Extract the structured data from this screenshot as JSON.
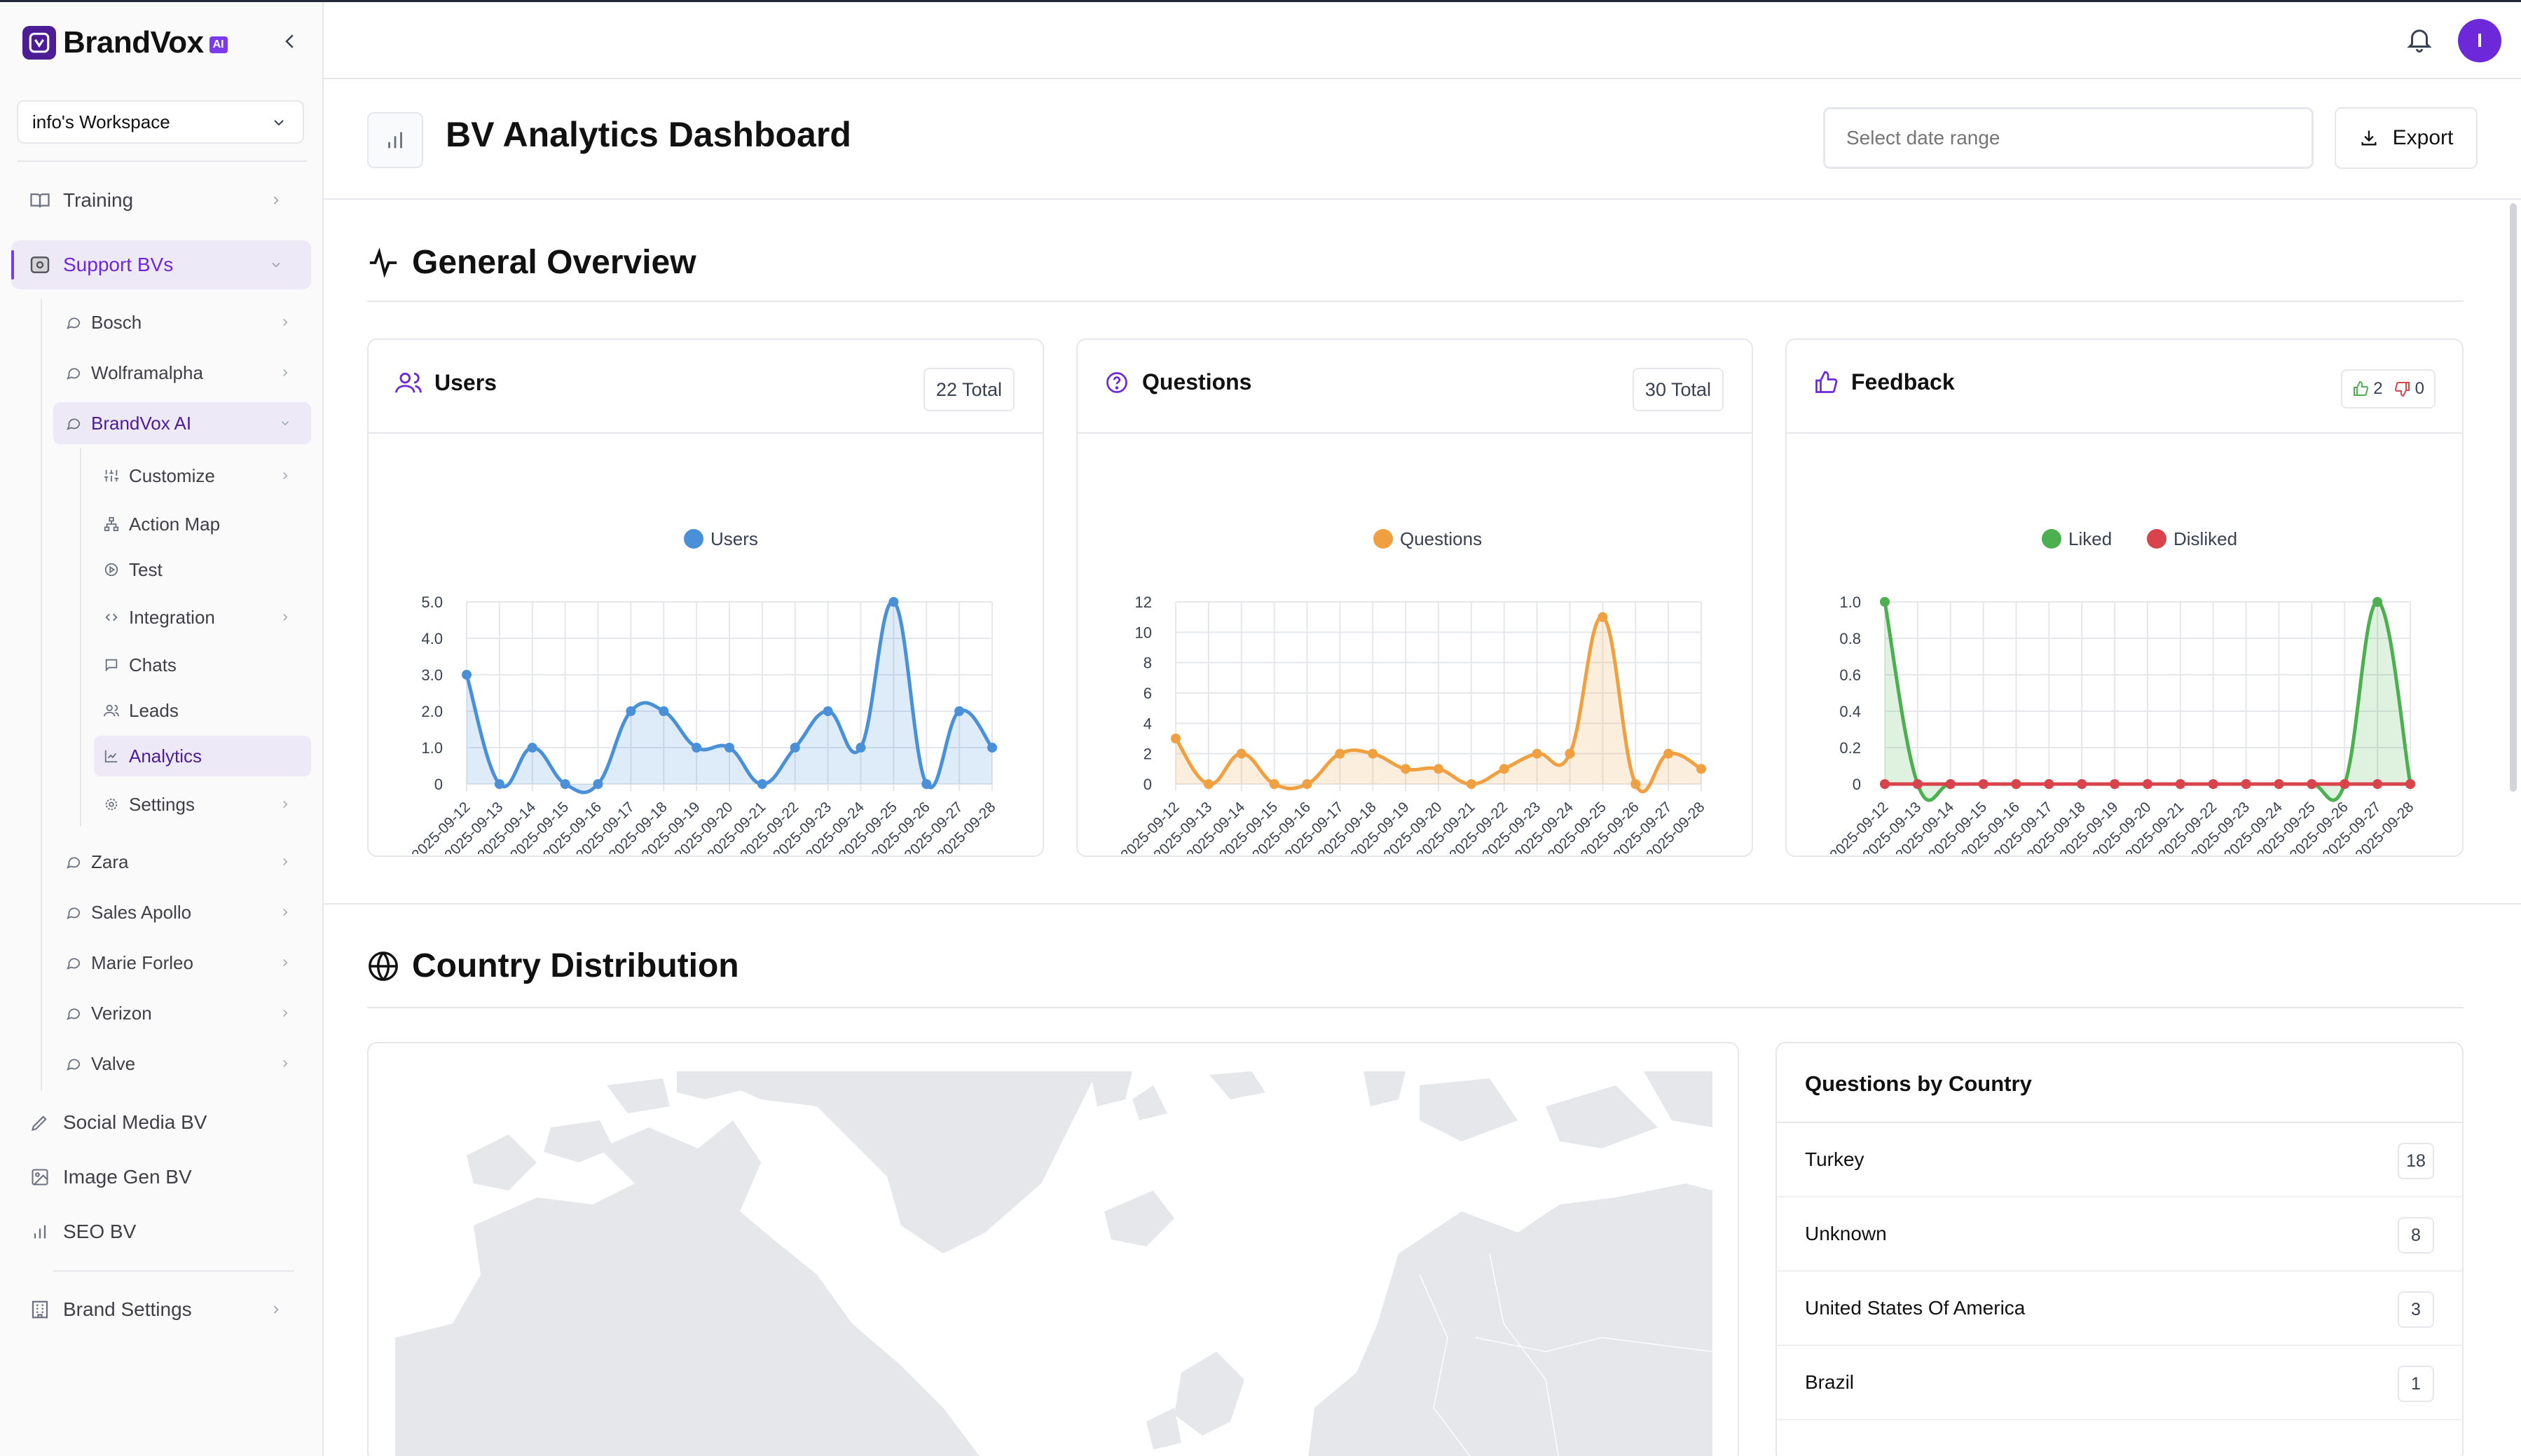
{
  "brand": {
    "name": "BrandVox",
    "badge": "AI"
  },
  "workspace": {
    "label": "info's Workspace"
  },
  "nav": {
    "training": "Training",
    "support_bvs": "Support BVs",
    "bots": {
      "bosch": "Bosch",
      "wolframalpha": "Wolframalpha",
      "brandvox_ai": "BrandVox AI",
      "zara": "Zara",
      "sales_apollo": "Sales Apollo",
      "marie_forleo": "Marie Forleo",
      "verizon": "Verizon",
      "valve": "Valve"
    },
    "bot_sub": {
      "customize": "Customize",
      "action_map": "Action Map",
      "test": "Test",
      "integration": "Integration",
      "chats": "Chats",
      "leads": "Leads",
      "analytics": "Analytics",
      "settings": "Settings"
    },
    "social_media": "Social Media BV",
    "image_gen": "Image Gen BV",
    "seo": "SEO BV",
    "brand_settings": "Brand Settings"
  },
  "user": {
    "initial": "I"
  },
  "page": {
    "title": "BV Analytics Dashboard",
    "date_placeholder": "Select date range",
    "export_label": "Export"
  },
  "sections": {
    "overview": "General Overview",
    "country": "Country Distribution"
  },
  "cards": {
    "users": {
      "title": "Users",
      "total": "22 Total"
    },
    "questions": {
      "title": "Questions",
      "total": "30 Total"
    },
    "feedback": {
      "title": "Feedback",
      "liked": "2",
      "disliked": "0"
    }
  },
  "colors": {
    "accent": "#6d28d9",
    "users": "#4a90d9",
    "questions": "#f0a040",
    "liked": "#4caf50",
    "disliked": "#d9434b"
  },
  "chart_data": [
    {
      "type": "line",
      "x": [
        "2025-09-12",
        "2025-09-13",
        "2025-09-14",
        "2025-09-15",
        "2025-09-16",
        "2025-09-17",
        "2025-09-18",
        "2025-09-19",
        "2025-09-20",
        "2025-09-21",
        "2025-09-22",
        "2025-09-23",
        "2025-09-24",
        "2025-09-25",
        "2025-09-26",
        "2025-09-27",
        "2025-09-28"
      ],
      "series": [
        {
          "name": "Users",
          "values": [
            3,
            0,
            1,
            0,
            0,
            2,
            2,
            1,
            1,
            0,
            1,
            2,
            1,
            5,
            0,
            2,
            1
          ]
        }
      ],
      "ylim": [
        0,
        5
      ],
      "yticks": [
        "0",
        "1.0",
        "2.0",
        "3.0",
        "4.0",
        "5.0"
      ],
      "legend": "top",
      "grid": true
    },
    {
      "type": "line",
      "x": [
        "2025-09-12",
        "2025-09-13",
        "2025-09-14",
        "2025-09-15",
        "2025-09-16",
        "2025-09-17",
        "2025-09-18",
        "2025-09-19",
        "2025-09-20",
        "2025-09-21",
        "2025-09-22",
        "2025-09-23",
        "2025-09-24",
        "2025-09-25",
        "2025-09-26",
        "2025-09-27",
        "2025-09-28"
      ],
      "series": [
        {
          "name": "Questions",
          "values": [
            3,
            0,
            2,
            0,
            0,
            2,
            2,
            1,
            1,
            0,
            1,
            2,
            2,
            11,
            0,
            2,
            1
          ]
        }
      ],
      "ylim": [
        0,
        12
      ],
      "yticks": [
        "0",
        "2",
        "4",
        "6",
        "8",
        "10",
        "12"
      ],
      "legend": "top",
      "grid": true
    },
    {
      "type": "line",
      "x": [
        "2025-09-12",
        "2025-09-13",
        "2025-09-14",
        "2025-09-15",
        "2025-09-16",
        "2025-09-17",
        "2025-09-18",
        "2025-09-19",
        "2025-09-20",
        "2025-09-21",
        "2025-09-22",
        "2025-09-23",
        "2025-09-24",
        "2025-09-25",
        "2025-09-26",
        "2025-09-27",
        "2025-09-28"
      ],
      "series": [
        {
          "name": "Liked",
          "values": [
            1,
            0,
            0,
            0,
            0,
            0,
            0,
            0,
            0,
            0,
            0,
            0,
            0,
            0,
            0,
            1,
            0
          ]
        },
        {
          "name": "Disliked",
          "values": [
            0,
            0,
            0,
            0,
            0,
            0,
            0,
            0,
            0,
            0,
            0,
            0,
            0,
            0,
            0,
            0,
            0
          ]
        }
      ],
      "ylim": [
        0,
        1
      ],
      "yticks": [
        "0",
        "0.2",
        "0.4",
        "0.6",
        "0.8",
        "1.0"
      ],
      "legend": "top",
      "grid": true
    }
  ],
  "questions_by_country": {
    "title": "Questions by Country",
    "rows": [
      {
        "country": "Turkey",
        "count": "18"
      },
      {
        "country": "Unknown",
        "count": "8"
      },
      {
        "country": "United States Of America",
        "count": "3"
      },
      {
        "country": "Brazil",
        "count": "1"
      }
    ]
  }
}
